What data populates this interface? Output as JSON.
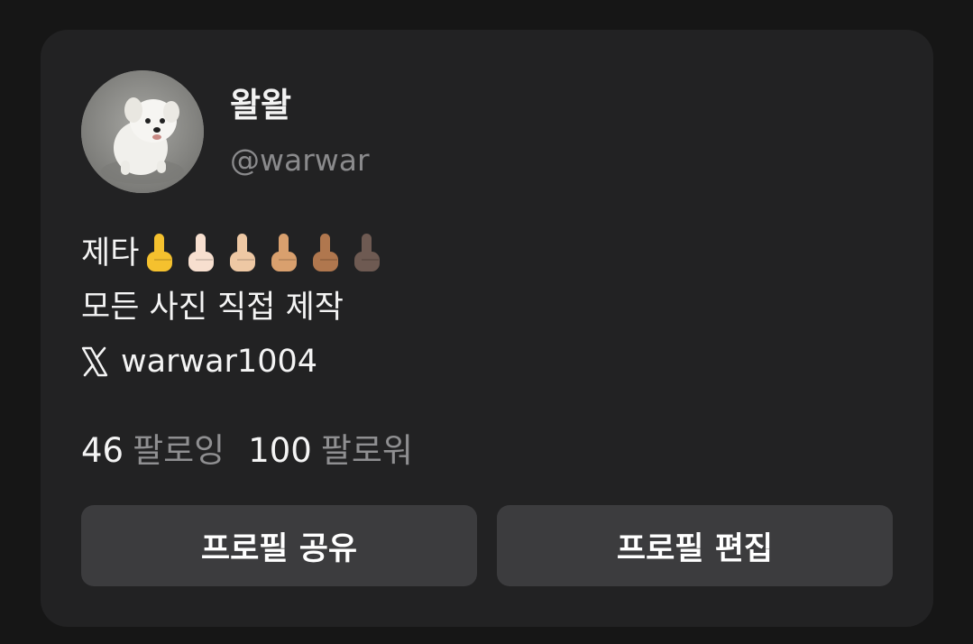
{
  "profile": {
    "display_name": "왈왈",
    "handle": "@warwar"
  },
  "bio": {
    "line1_text": "제타",
    "line1_emojis": [
      "middle-finger-default",
      "middle-finger-light",
      "middle-finger-medium-light",
      "middle-finger-medium",
      "middle-finger-medium-dark",
      "middle-finger-dark"
    ],
    "line2": "모든 사진 직접 제작",
    "line3": "warwar1004",
    "line3_icon": "x-logo-icon"
  },
  "stats": {
    "following_count": "46",
    "following_label": "팔로잉",
    "followers_count": "100",
    "followers_label": "팔로워"
  },
  "buttons": {
    "share_label": "프로필 공유",
    "edit_label": "프로필 편집"
  },
  "colors": {
    "background": "#161616",
    "card": "#222223",
    "button": "#3c3c3e",
    "muted_text": "#8a8a8c",
    "emoji_tones": [
      "#f5c12e",
      "#f7dfcf",
      "#eec8a4",
      "#d9a06e",
      "#b0774e",
      "#6e5a52"
    ]
  }
}
